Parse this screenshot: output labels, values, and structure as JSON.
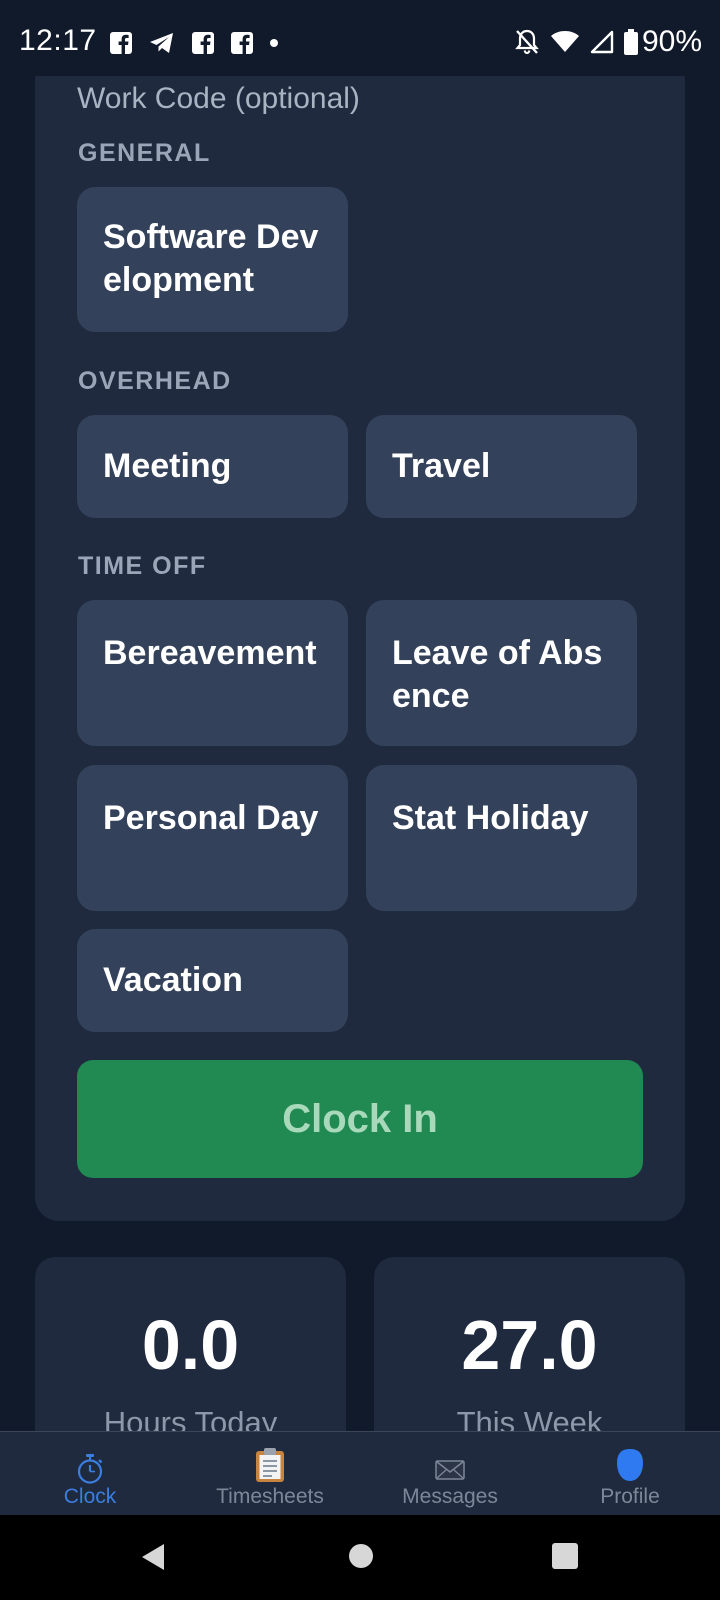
{
  "status_bar": {
    "time": "12:17",
    "battery": "90%",
    "notification_icons": [
      "facebook-icon",
      "telegram-icon",
      "facebook-icon",
      "facebook-icon",
      "dot-icon"
    ],
    "system_icons": [
      "bell-off-icon",
      "wifi-icon",
      "cell-signal-icon",
      "battery-icon"
    ]
  },
  "work_code": {
    "label": "Work Code (optional)",
    "sections": {
      "general": {
        "title": "GENERAL",
        "items": [
          "Software Development"
        ]
      },
      "overhead": {
        "title": "OVERHEAD",
        "items": [
          "Meeting",
          "Travel"
        ]
      },
      "time_off": {
        "title": "TIME OFF",
        "items": [
          "Bereavement",
          "Leave of Absence",
          "Personal Day",
          "Stat Holiday",
          "Vacation"
        ]
      }
    }
  },
  "clock_in": {
    "label": "Clock In"
  },
  "stats": {
    "hours_today": {
      "value": "0.0",
      "label": "Hours Today"
    },
    "this_week": {
      "value": "27.0",
      "label": "This Week"
    }
  },
  "bottom_nav": {
    "items": [
      {
        "label": "Clock",
        "icon": "stopwatch-icon",
        "active": true
      },
      {
        "label": "Timesheets",
        "icon": "clipboard-icon",
        "active": false
      },
      {
        "label": "Messages",
        "icon": "envelope-icon",
        "active": false
      },
      {
        "label": "Profile",
        "icon": "profile-icon",
        "active": false
      }
    ]
  },
  "colors": {
    "background": "#111a2b",
    "card": "#1f2a3e",
    "button": "#33415a",
    "clock_in": "#208a52",
    "active_nav": "#3b7ee0"
  }
}
